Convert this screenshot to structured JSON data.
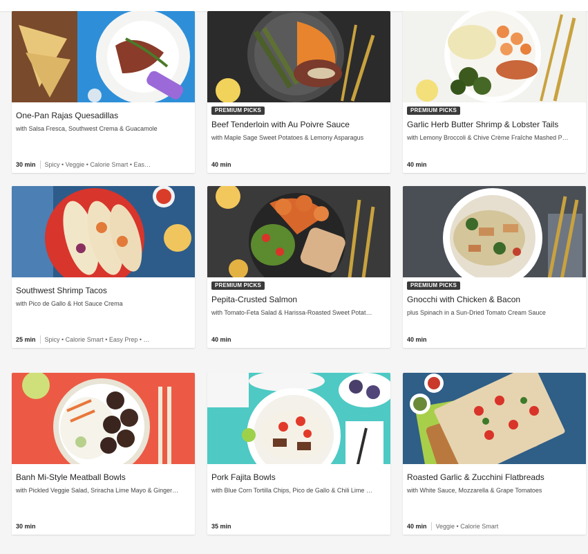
{
  "recipes": [
    {
      "title": "One-Pan Rajas Quesadillas",
      "subtitle": "with Salsa Fresca, Southwest Crema & Guacamole",
      "badge": "",
      "time": "30 min",
      "tags": "Spicy • Veggie • Calorie Smart • Eas…"
    },
    {
      "title": "Beef Tenderloin with Au Poivre Sauce",
      "subtitle": "with Maple Sage Sweet Potatoes & Lemony Asparagus",
      "badge": "PREMIUM PICKS",
      "time": "40 min",
      "tags": ""
    },
    {
      "title": "Garlic Herb Butter Shrimp & Lobster Tails",
      "subtitle": "with Lemony Broccoli & Chive Crème Fraîche Mashed P…",
      "badge": "PREMIUM PICKS",
      "time": "40 min",
      "tags": ""
    },
    {
      "title": "Southwest Shrimp Tacos",
      "subtitle": "with Pico de Gallo & Hot Sauce Crema",
      "badge": "",
      "time": "25 min",
      "tags": "Spicy • Calorie Smart • Easy Prep • …"
    },
    {
      "title": "Pepita-Crusted Salmon",
      "subtitle": "with Tomato-Feta Salad & Harissa-Roasted Sweet Potat…",
      "badge": "PREMIUM PICKS",
      "time": "40 min",
      "tags": ""
    },
    {
      "title": "Gnocchi with Chicken & Bacon",
      "subtitle": "plus Spinach in a Sun-Dried Tomato Cream Sauce",
      "badge": "PREMIUM PICKS",
      "time": "40 min",
      "tags": ""
    },
    {
      "title": "Banh Mi-Style Meatball Bowls",
      "subtitle": "with Pickled Veggie Salad, Sriracha Lime Mayo & Ginger…",
      "badge": "",
      "time": "30 min",
      "tags": ""
    },
    {
      "title": "Pork Fajita Bowls",
      "subtitle": "with Blue Corn Tortilla Chips, Pico de Gallo & Chili Lime …",
      "badge": "",
      "time": "35 min",
      "tags": ""
    },
    {
      "title": "Roasted Garlic & Zucchini Flatbreads",
      "subtitle": "with White Sauce, Mozzarella & Grape Tomatoes",
      "badge": "",
      "time": "40 min",
      "tags": "Veggie • Calorie Smart"
    }
  ]
}
